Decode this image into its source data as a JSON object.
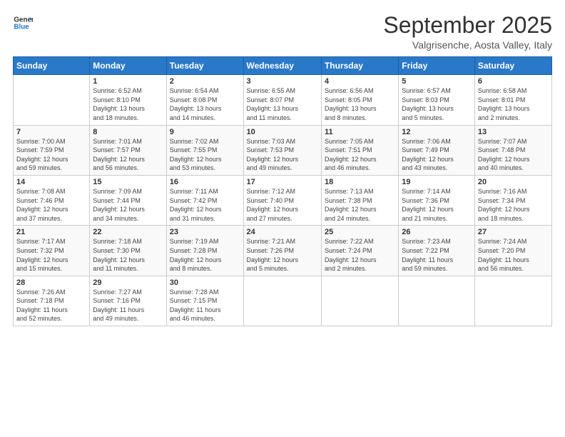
{
  "logo": {
    "line1": "General",
    "line2": "Blue"
  },
  "header": {
    "title": "September 2025",
    "location": "Valgrisenche, Aosta Valley, Italy"
  },
  "weekdays": [
    "Sunday",
    "Monday",
    "Tuesday",
    "Wednesday",
    "Thursday",
    "Friday",
    "Saturday"
  ],
  "weeks": [
    [
      {
        "day": "",
        "info": ""
      },
      {
        "day": "1",
        "info": "Sunrise: 6:52 AM\nSunset: 8:10 PM\nDaylight: 13 hours\nand 18 minutes."
      },
      {
        "day": "2",
        "info": "Sunrise: 6:54 AM\nSunset: 8:08 PM\nDaylight: 13 hours\nand 14 minutes."
      },
      {
        "day": "3",
        "info": "Sunrise: 6:55 AM\nSunset: 8:07 PM\nDaylight: 13 hours\nand 11 minutes."
      },
      {
        "day": "4",
        "info": "Sunrise: 6:56 AM\nSunset: 8:05 PM\nDaylight: 13 hours\nand 8 minutes."
      },
      {
        "day": "5",
        "info": "Sunrise: 6:57 AM\nSunset: 8:03 PM\nDaylight: 13 hours\nand 5 minutes."
      },
      {
        "day": "6",
        "info": "Sunrise: 6:58 AM\nSunset: 8:01 PM\nDaylight: 13 hours\nand 2 minutes."
      }
    ],
    [
      {
        "day": "7",
        "info": "Sunrise: 7:00 AM\nSunset: 7:59 PM\nDaylight: 12 hours\nand 59 minutes."
      },
      {
        "day": "8",
        "info": "Sunrise: 7:01 AM\nSunset: 7:57 PM\nDaylight: 12 hours\nand 56 minutes."
      },
      {
        "day": "9",
        "info": "Sunrise: 7:02 AM\nSunset: 7:55 PM\nDaylight: 12 hours\nand 53 minutes."
      },
      {
        "day": "10",
        "info": "Sunrise: 7:03 AM\nSunset: 7:53 PM\nDaylight: 12 hours\nand 49 minutes."
      },
      {
        "day": "11",
        "info": "Sunrise: 7:05 AM\nSunset: 7:51 PM\nDaylight: 12 hours\nand 46 minutes."
      },
      {
        "day": "12",
        "info": "Sunrise: 7:06 AM\nSunset: 7:49 PM\nDaylight: 12 hours\nand 43 minutes."
      },
      {
        "day": "13",
        "info": "Sunrise: 7:07 AM\nSunset: 7:48 PM\nDaylight: 12 hours\nand 40 minutes."
      }
    ],
    [
      {
        "day": "14",
        "info": "Sunrise: 7:08 AM\nSunset: 7:46 PM\nDaylight: 12 hours\nand 37 minutes."
      },
      {
        "day": "15",
        "info": "Sunrise: 7:09 AM\nSunset: 7:44 PM\nDaylight: 12 hours\nand 34 minutes."
      },
      {
        "day": "16",
        "info": "Sunrise: 7:11 AM\nSunset: 7:42 PM\nDaylight: 12 hours\nand 31 minutes."
      },
      {
        "day": "17",
        "info": "Sunrise: 7:12 AM\nSunset: 7:40 PM\nDaylight: 12 hours\nand 27 minutes."
      },
      {
        "day": "18",
        "info": "Sunrise: 7:13 AM\nSunset: 7:38 PM\nDaylight: 12 hours\nand 24 minutes."
      },
      {
        "day": "19",
        "info": "Sunrise: 7:14 AM\nSunset: 7:36 PM\nDaylight: 12 hours\nand 21 minutes."
      },
      {
        "day": "20",
        "info": "Sunrise: 7:16 AM\nSunset: 7:34 PM\nDaylight: 12 hours\nand 18 minutes."
      }
    ],
    [
      {
        "day": "21",
        "info": "Sunrise: 7:17 AM\nSunset: 7:32 PM\nDaylight: 12 hours\nand 15 minutes."
      },
      {
        "day": "22",
        "info": "Sunrise: 7:18 AM\nSunset: 7:30 PM\nDaylight: 12 hours\nand 11 minutes."
      },
      {
        "day": "23",
        "info": "Sunrise: 7:19 AM\nSunset: 7:28 PM\nDaylight: 12 hours\nand 8 minutes."
      },
      {
        "day": "24",
        "info": "Sunrise: 7:21 AM\nSunset: 7:26 PM\nDaylight: 12 hours\nand 5 minutes."
      },
      {
        "day": "25",
        "info": "Sunrise: 7:22 AM\nSunset: 7:24 PM\nDaylight: 12 hours\nand 2 minutes."
      },
      {
        "day": "26",
        "info": "Sunrise: 7:23 AM\nSunset: 7:22 PM\nDaylight: 11 hours\nand 59 minutes."
      },
      {
        "day": "27",
        "info": "Sunrise: 7:24 AM\nSunset: 7:20 PM\nDaylight: 11 hours\nand 56 minutes."
      }
    ],
    [
      {
        "day": "28",
        "info": "Sunrise: 7:26 AM\nSunset: 7:18 PM\nDaylight: 11 hours\nand 52 minutes."
      },
      {
        "day": "29",
        "info": "Sunrise: 7:27 AM\nSunset: 7:16 PM\nDaylight: 11 hours\nand 49 minutes."
      },
      {
        "day": "30",
        "info": "Sunrise: 7:28 AM\nSunset: 7:15 PM\nDaylight: 11 hours\nand 46 minutes."
      },
      {
        "day": "",
        "info": ""
      },
      {
        "day": "",
        "info": ""
      },
      {
        "day": "",
        "info": ""
      },
      {
        "day": "",
        "info": ""
      }
    ]
  ]
}
